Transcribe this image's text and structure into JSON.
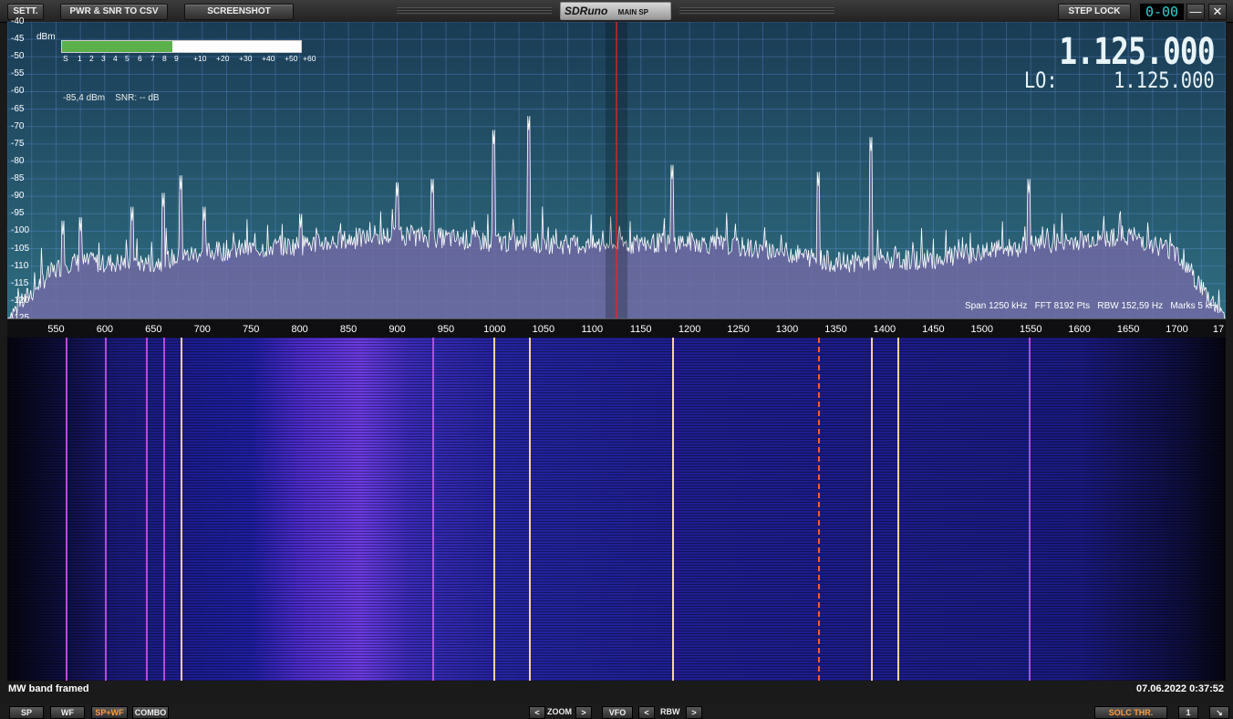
{
  "toolbar": {
    "settings": "SETT.",
    "pwr_snr": "PWR & SNR TO CSV",
    "screenshot": "SCREENSHOT",
    "step_lock": "STEP LOCK",
    "brand": "SDRuno",
    "window_name": "MAIN SP",
    "digit_display": "0-00",
    "minimize": "—",
    "close": "✕"
  },
  "spectrum": {
    "unit": "dBm",
    "y_ticks": [
      "-40",
      "-45",
      "-50",
      "-55",
      "-60",
      "-65",
      "-70",
      "-75",
      "-80",
      "-85",
      "-90",
      "-95",
      "-100",
      "-105",
      "-110",
      "-115",
      "-120",
      "-125"
    ],
    "smeter_scale": [
      "S",
      "1",
      "2",
      "3",
      "4",
      "5",
      "6",
      "7",
      "8",
      "9",
      "+10",
      "+20",
      "+30",
      "+40",
      "+50",
      "+60"
    ],
    "smeter_level_fraction": 0.46,
    "level_readout": "-85,4 dBm    SNR: -- dB",
    "frequency": "1.125.000",
    "lo_label": "LO:",
    "lo_frequency": "1.125.000",
    "span_info": "Span 1250 kHz   FFT 8192 Pts   RBW 152,59 Hz   Marks 5 kH",
    "x_ticks": [
      "550",
      "600",
      "650",
      "700",
      "750",
      "800",
      "850",
      "900",
      "950",
      "1000",
      "1050",
      "1100",
      "1150",
      "1200",
      "1250",
      "1300",
      "1350",
      "1400",
      "1450",
      "1500",
      "1550",
      "1600",
      "1650",
      "1700",
      "17"
    ]
  },
  "chart_data": {
    "type": "line",
    "xlabel": "",
    "ylabel": "dBm",
    "xlim": [
      500,
      1750
    ],
    "ylim": [
      -125,
      -40
    ],
    "center_marker_khz": 1125,
    "peaks": [
      {
        "x": 557,
        "y": -101
      },
      {
        "x": 575,
        "y": -100
      },
      {
        "x": 628,
        "y": -97
      },
      {
        "x": 660,
        "y": -93
      },
      {
        "x": 678,
        "y": -88
      },
      {
        "x": 702,
        "y": -97
      },
      {
        "x": 801,
        "y": -99
      },
      {
        "x": 900,
        "y": -90
      },
      {
        "x": 936,
        "y": -89
      },
      {
        "x": 999,
        "y": -75
      },
      {
        "x": 1035,
        "y": -71
      },
      {
        "x": 1182,
        "y": -85
      },
      {
        "x": 1332,
        "y": -87
      },
      {
        "x": 1386,
        "y": -77
      },
      {
        "x": 1548,
        "y": -89
      }
    ],
    "noise_floor": [
      {
        "x": 500,
        "y": -125
      },
      {
        "x": 540,
        "y": -113
      },
      {
        "x": 560,
        "y": -109
      },
      {
        "x": 650,
        "y": -109
      },
      {
        "x": 700,
        "y": -106
      },
      {
        "x": 800,
        "y": -104
      },
      {
        "x": 900,
        "y": -101
      },
      {
        "x": 1000,
        "y": -103
      },
      {
        "x": 1100,
        "y": -104
      },
      {
        "x": 1200,
        "y": -103
      },
      {
        "x": 1300,
        "y": -106
      },
      {
        "x": 1350,
        "y": -109
      },
      {
        "x": 1450,
        "y": -108
      },
      {
        "x": 1550,
        "y": -104
      },
      {
        "x": 1650,
        "y": -101
      },
      {
        "x": 1700,
        "y": -106
      },
      {
        "x": 1730,
        "y": -118
      },
      {
        "x": 1750,
        "y": -125
      }
    ]
  },
  "waterfall": {
    "strong_carriers_khz": [
      678,
      999,
      1035,
      1182,
      1386,
      1413
    ],
    "dashed_carriers_khz": [
      1332
    ],
    "purple_carriers_khz": [
      560,
      600,
      642,
      660,
      936,
      1548
    ]
  },
  "footer": {
    "label": "MW band framed",
    "datetime": "07.06.2022 0:37:52"
  },
  "bottom": {
    "sp": "SP",
    "wf": "WF",
    "spwf": "SP+WF",
    "combo": "COMBO",
    "zoom": "ZOOM",
    "vfo": "VFO",
    "rbw": "RBW",
    "prev": "<",
    "next": ">",
    "solc": "SOLC THR.",
    "one": "1",
    "resize": "↘"
  },
  "colors": {
    "smeter_fill": "#5bb04a",
    "trace": "#ffffff",
    "trace_fill": "#7a6aa8",
    "marker": "#ff2020"
  }
}
